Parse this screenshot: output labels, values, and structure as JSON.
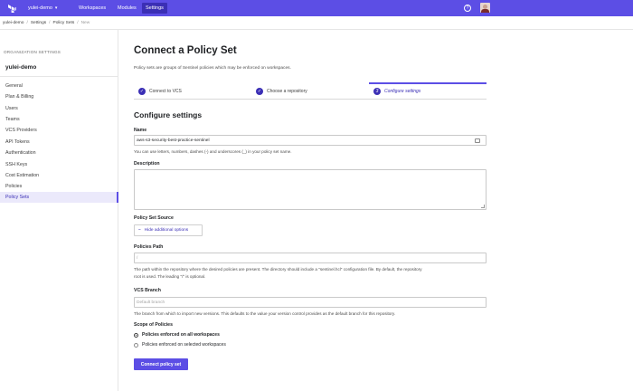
{
  "nav": {
    "org": "yulei-demo",
    "org_chevron": "▾",
    "items": [
      "Workspaces",
      "Modules",
      "Settings"
    ],
    "help_icon": "?"
  },
  "breadcrumb": [
    "yulei-demo",
    "Settings",
    "Policy Sets",
    "New"
  ],
  "sidebar": {
    "heading": "ORGANIZATION SETTINGS",
    "org": "yulei-demo",
    "items": [
      "General",
      "Plan & Billing",
      "Users",
      "Teams",
      "VCS Providers",
      "API Tokens",
      "Authentication",
      "SSH Keys",
      "Cost Estimation",
      "Policies",
      "Policy Sets"
    ],
    "active_index": 10
  },
  "main": {
    "title": "Connect a Policy Set",
    "description": "Policy sets are groups of Sentinel policies which may be enforced on workspaces.",
    "steps": [
      {
        "label": "Connect to VCS",
        "icon": "✓"
      },
      {
        "label": "Choose a repository",
        "icon": "✓"
      },
      {
        "label": "Configure settings",
        "icon": "3"
      }
    ],
    "section_title": "Configure settings",
    "name_label": "Name",
    "name_value": "aws-s3-security-best-practice-sentinel",
    "name_help": "You can use letters, numbers, dashes (-) and underscores (_) in your policy set name.",
    "description_label": "Description",
    "source_label": "Policy Set Source",
    "hide_options": "Hide additional options",
    "hide_options_icon": "–",
    "policies_path_label": "Policies Path",
    "policies_path_value": "/",
    "policies_path_help_1": "The path within the repository where the desired policies are present. The directory should include a \"sentinel.hcl\" configuration file. By default, the repository",
    "policies_path_help_2": "root is used. The leading \"/\" is optional.",
    "vcs_branch_label": "VCS Branch",
    "vcs_branch_placeholder": "Default branch",
    "vcs_branch_help": "The branch from which to import new versions. This defaults to the value your version control provides as the default branch for this repository.",
    "scope_label": "Scope of Policies",
    "scope_options": [
      "Policies enforced on all workspaces",
      "Policies enforced on selected workspaces"
    ],
    "scope_selected": 0,
    "submit_label": "Connect policy set"
  },
  "colors": {
    "brand": "#5c4ee5",
    "brand_dark": "#3b2fb5"
  }
}
